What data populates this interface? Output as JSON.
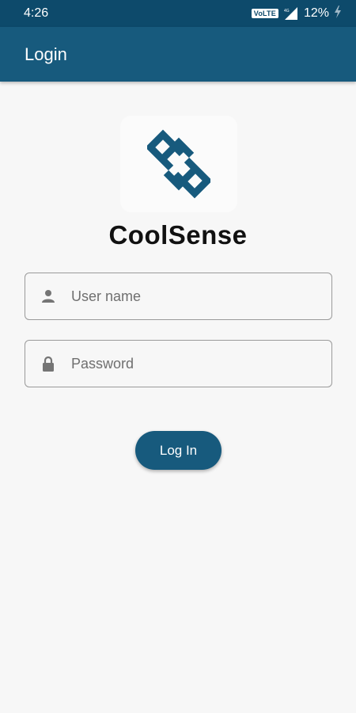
{
  "status_bar": {
    "time": "4:26",
    "network_badge": "VoLTE",
    "battery_percent": "12%",
    "icons": [
      "signal-icon",
      "charging-icon"
    ]
  },
  "app_bar": {
    "title": "Login"
  },
  "brand": {
    "name": "CoolSense",
    "logo_color": "#175a7d"
  },
  "form": {
    "username": {
      "placeholder": "User name",
      "value": "",
      "icon": "person-icon"
    },
    "password": {
      "placeholder": "Password",
      "value": "",
      "icon": "lock-icon"
    },
    "submit_label": "Log In"
  },
  "colors": {
    "primary": "#175a7d",
    "status_bar": "#0d4a6b",
    "background": "#f7f7f7"
  }
}
